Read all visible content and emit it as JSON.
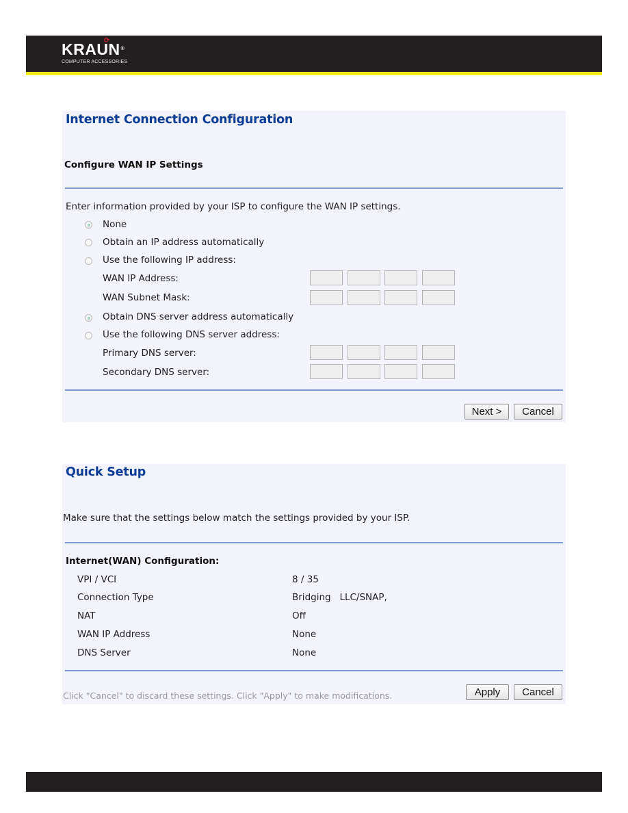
{
  "brand": {
    "name": "KRAUN",
    "registered_mark": "®",
    "tagline": "COMPUTER ACCESSORIES",
    "colors": {
      "header": "#231f20",
      "stripe": "#f4ea1a",
      "title_blue": "#0a3d96",
      "divider": "#7e98d1",
      "panel_bg": "#f2f3fb"
    }
  },
  "wan_config": {
    "title": "Internet Connection Configuration",
    "subtitle": "Configure WAN IP Settings",
    "instructions": "Enter information provided by your ISP to configure the WAN IP settings.",
    "ip_options": [
      {
        "label": "None",
        "checked": true
      },
      {
        "label": "Obtain an IP address automatically",
        "checked": false
      },
      {
        "label": "Use the following IP address:",
        "checked": false
      }
    ],
    "ip_fields": [
      {
        "label": "WAN IP Address:",
        "octets": [
          "",
          "",
          "",
          ""
        ]
      },
      {
        "label": "WAN Subnet Mask:",
        "octets": [
          "",
          "",
          "",
          ""
        ]
      }
    ],
    "dns_options": [
      {
        "label": "Obtain DNS server address automatically",
        "checked": true
      },
      {
        "label": "Use the following DNS server address:",
        "checked": false
      }
    ],
    "dns_fields": [
      {
        "label": "Primary DNS server:",
        "octets": [
          "",
          "",
          "",
          ""
        ]
      },
      {
        "label": "Secondary DNS server:",
        "octets": [
          "",
          "",
          "",
          ""
        ]
      }
    ],
    "buttons": {
      "next": "Next >",
      "cancel": "Cancel"
    }
  },
  "quick_setup": {
    "title": "Quick Setup",
    "instructions": "Make sure that the settings below match the settings provided by your ISP.",
    "section_heading": "Internet(WAN) Configuration:",
    "rows": [
      {
        "label": "VPI / VCI",
        "value": "8 / 35"
      },
      {
        "label": "Connection Type",
        "value": "Bridging   LLC/SNAP,"
      },
      {
        "label": "NAT",
        "value": "Off"
      },
      {
        "label": "WAN IP Address",
        "value": "None"
      },
      {
        "label": "DNS Server",
        "value": "None"
      }
    ],
    "hint": "Click \"Cancel\" to discard these settings. Click \"Apply\" to make modifications.",
    "buttons": {
      "apply": "Apply",
      "cancel": "Cancel"
    }
  }
}
